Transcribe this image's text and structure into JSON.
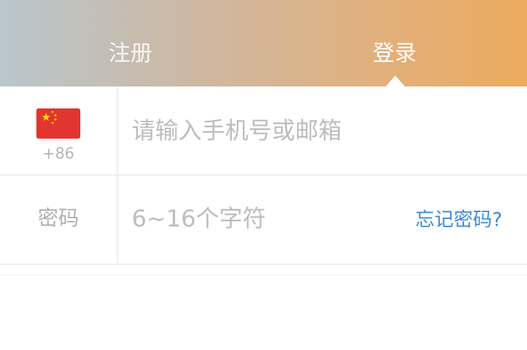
{
  "tabs": {
    "register_label": "注册",
    "login_label": "登录",
    "active": "login"
  },
  "phone": {
    "flag_icon": "china-flag-icon",
    "country_code": "+86",
    "placeholder": "请输入手机号或邮箱",
    "value": ""
  },
  "password": {
    "label": "密码",
    "placeholder": "6~16个字符",
    "value": "",
    "forgot_label": "忘记密码?"
  },
  "colors": {
    "gradient_start": "#b9c6cc",
    "gradient_end": "#ecab5d",
    "link": "#3f8bd8"
  }
}
